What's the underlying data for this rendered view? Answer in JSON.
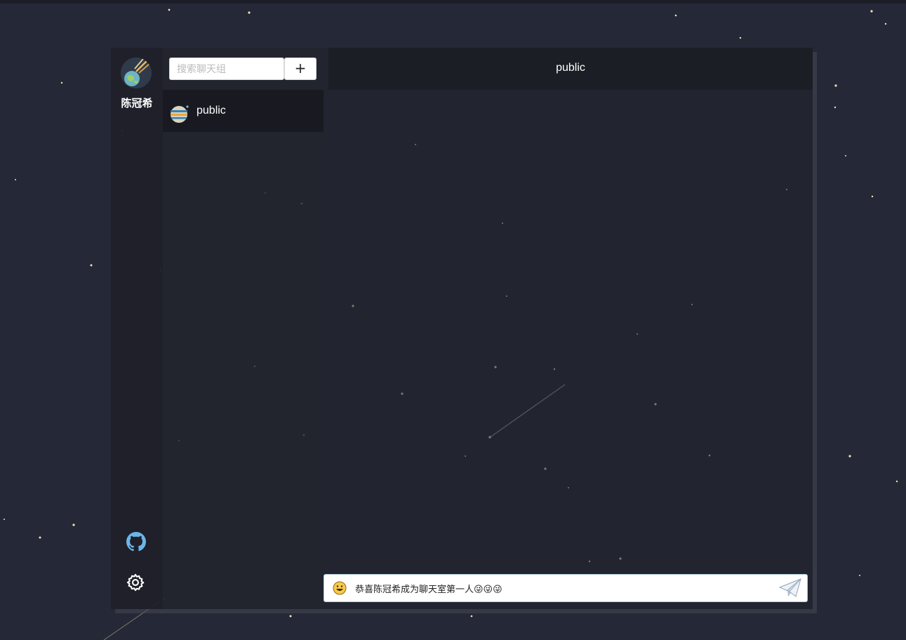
{
  "user": {
    "name": "陈冠希",
    "avatar_icon": "meteor-planet-avatar"
  },
  "search": {
    "placeholder": "搜索聊天组",
    "value": ""
  },
  "add_button": {
    "label": "+"
  },
  "groups": [
    {
      "name": "public",
      "icon": "planet-icon"
    }
  ],
  "chat": {
    "title": "public"
  },
  "composer": {
    "value": "恭喜陈冠希成为聊天室第一人😜😜😜",
    "emoji_icon": "smiley-face-icon",
    "send_icon": "paper-plane-icon"
  },
  "sidebar": {
    "github_icon": "github-icon",
    "settings_icon": "gear-icon"
  },
  "colors": {
    "background": "#252836",
    "star": "#f4e3b0",
    "github": "#6bb6e8"
  }
}
